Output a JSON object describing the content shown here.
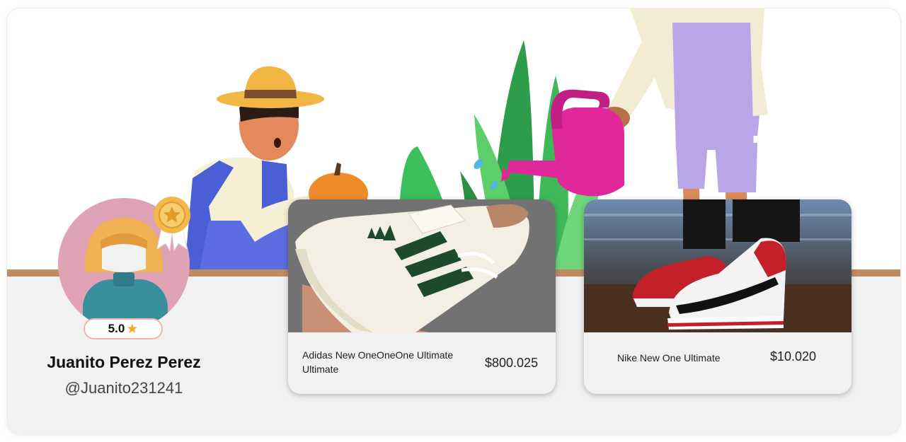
{
  "user": {
    "name": "Juanito Perez Perez",
    "handle": "@Juanito231241",
    "rating": "5.0",
    "rating_icon": "star-icon",
    "badge_icon": "award-medal-icon"
  },
  "products": [
    {
      "name": "Adidas New OneOneOne Ultimate Ultimate",
      "price": "$800.025",
      "image": "adidas-sneaker-photo"
    },
    {
      "name": "Nike New One Ultimate",
      "price": "$10.020",
      "image": "nike-sneaker-photo"
    }
  ],
  "colors": {
    "rating_border": "#f4b3ab",
    "star": "#f5a623",
    "ground": "#c08a62",
    "panel": "#f1f1f1"
  }
}
